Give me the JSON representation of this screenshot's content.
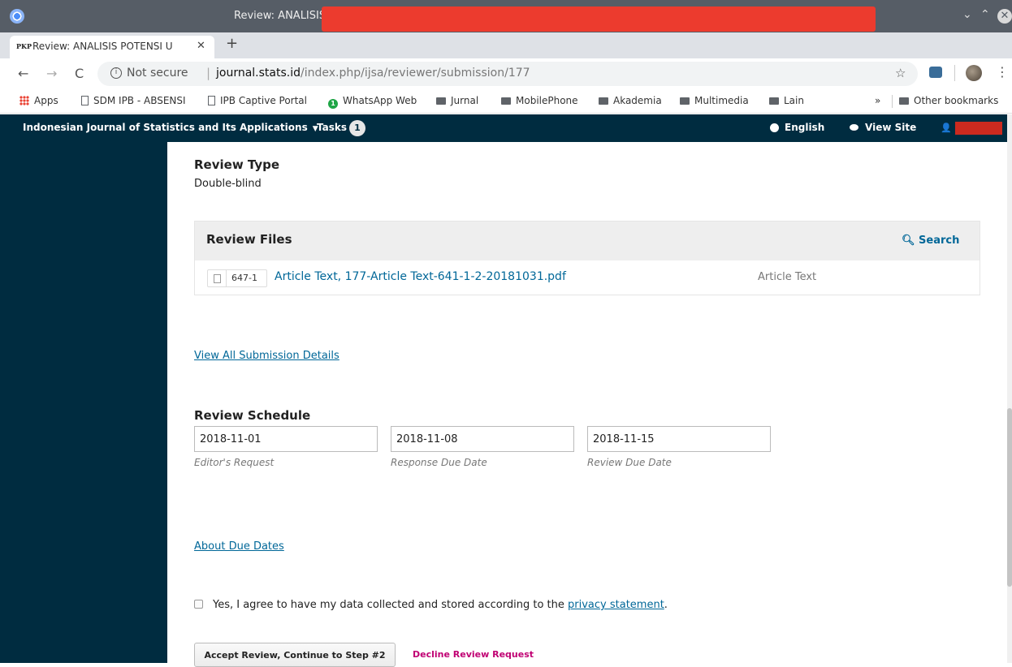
{
  "window": {
    "title": "Review: ANALISIS",
    "controls": {
      "minimize": "⌄",
      "maximize": "⌃",
      "close": "✕"
    }
  },
  "tabs": [
    {
      "favicon": "PKP",
      "label": "Review: ANALISIS POTENSI U",
      "close": "✕"
    }
  ],
  "new_tab": "+",
  "address_bar": {
    "security": "Not secure",
    "separator": "|",
    "host": "journal.stats.id",
    "path": "/index.php/ijsa/reviewer/submission/177"
  },
  "bookmarks": {
    "items": [
      {
        "label": "Apps",
        "icon": "apps-grid-icon"
      },
      {
        "label": "SDM IPB - ABSENSI",
        "icon": "page-icon"
      },
      {
        "label": "IPB Captive Portal",
        "icon": "page-icon"
      },
      {
        "label": "WhatsApp Web",
        "icon": "whatsapp-icon"
      },
      {
        "label": "Jurnal",
        "icon": "folder-icon"
      },
      {
        "label": "MobilePhone",
        "icon": "folder-icon"
      },
      {
        "label": "Akademia",
        "icon": "folder-icon"
      },
      {
        "label": "Multimedia",
        "icon": "folder-icon"
      },
      {
        "label": "Lain",
        "icon": "folder-icon"
      }
    ],
    "overflow": "»",
    "other": "Other bookmarks"
  },
  "ojs_header": {
    "journal": "Indonesian Journal of Statistics and Its Applications",
    "tasks_label": "Tasks",
    "tasks_count": "1",
    "language": "English",
    "view_site": "View Site"
  },
  "review": {
    "type_heading": "Review Type",
    "type_value": "Double-blind",
    "files_heading": "Review Files",
    "search_label": "Search",
    "files": [
      {
        "id": "647-1",
        "name": "Article Text, 177-Article Text-641-1-2-20181031.pdf",
        "type": "Article Text"
      }
    ],
    "details_link": "View All Submission Details",
    "schedule_heading": "Review Schedule",
    "schedule": [
      {
        "value": "2018-11-01",
        "label": "Editor's Request"
      },
      {
        "value": "2018-11-08",
        "label": "Response Due Date"
      },
      {
        "value": "2018-11-15",
        "label": "Review Due Date"
      }
    ],
    "due_dates_link": "About Due Dates",
    "consent_text": "Yes, I agree to have my data collected and stored according to the ",
    "consent_link": "privacy statement",
    "consent_end": ".",
    "accept_button": "Accept Review, Continue to Step #2",
    "decline_link": "Decline Review Request"
  },
  "colors": {
    "ojs_navy": "#002c40",
    "link_blue": "#006798",
    "decline_magenta": "#c00073",
    "redaction_red": "#ec3b2e"
  }
}
